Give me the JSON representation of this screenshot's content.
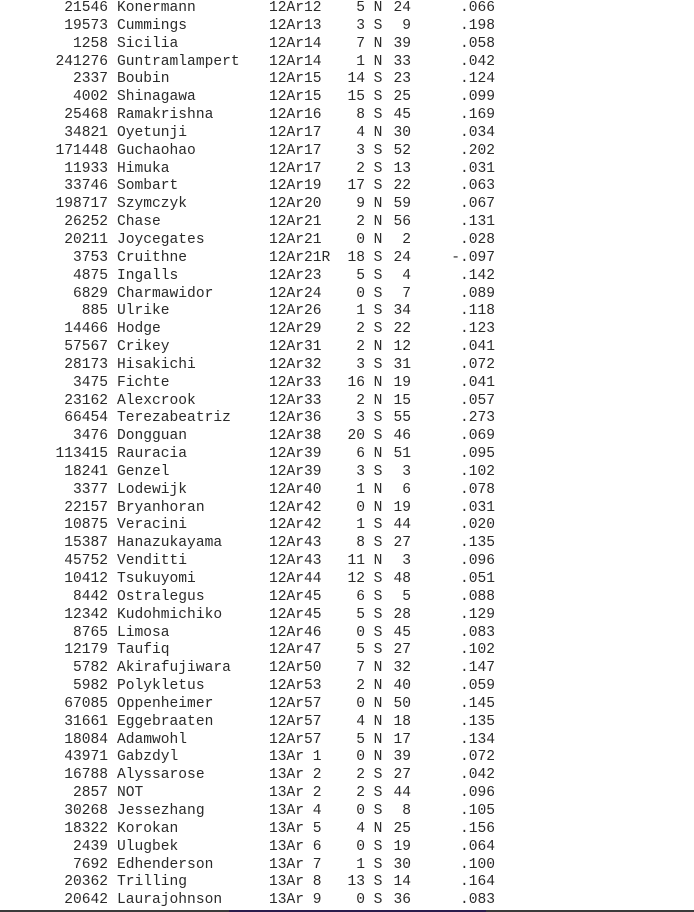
{
  "listing": {
    "rows": [
      {
        "number": "21546",
        "name": "Konermann",
        "code": "12Ar12",
        "deg": "5",
        "hem": "N",
        "min": "24",
        "value": ".066"
      },
      {
        "number": "19573",
        "name": "Cummings",
        "code": "12Ar13",
        "deg": "3",
        "hem": "S",
        "min": "9",
        "value": ".198"
      },
      {
        "number": "1258",
        "name": "Sicilia",
        "code": "12Ar14",
        "deg": "7",
        "hem": "N",
        "min": "39",
        "value": ".058"
      },
      {
        "number": "241276",
        "name": "Guntramlampert",
        "code": "12Ar14",
        "deg": "1",
        "hem": "N",
        "min": "33",
        "value": ".042"
      },
      {
        "number": "2337",
        "name": "Boubin",
        "code": "12Ar15",
        "deg": "14",
        "hem": "S",
        "min": "23",
        "value": ".124"
      },
      {
        "number": "4002",
        "name": "Shinagawa",
        "code": "12Ar15",
        "deg": "15",
        "hem": "S",
        "min": "25",
        "value": ".099"
      },
      {
        "number": "25468",
        "name": "Ramakrishna",
        "code": "12Ar16",
        "deg": "8",
        "hem": "S",
        "min": "45",
        "value": ".169"
      },
      {
        "number": "34821",
        "name": "Oyetunji",
        "code": "12Ar17",
        "deg": "4",
        "hem": "N",
        "min": "30",
        "value": ".034"
      },
      {
        "number": "171448",
        "name": "Guchaohao",
        "code": "12Ar17",
        "deg": "3",
        "hem": "S",
        "min": "52",
        "value": ".202"
      },
      {
        "number": "11933",
        "name": "Himuka",
        "code": "12Ar17",
        "deg": "2",
        "hem": "S",
        "min": "13",
        "value": ".031"
      },
      {
        "number": "33746",
        "name": "Sombart",
        "code": "12Ar19",
        "deg": "17",
        "hem": "S",
        "min": "22",
        "value": ".063"
      },
      {
        "number": "198717",
        "name": "Szymczyk",
        "code": "12Ar20",
        "deg": "9",
        "hem": "N",
        "min": "59",
        "value": ".067"
      },
      {
        "number": "26252",
        "name": "Chase",
        "code": "12Ar21",
        "deg": "2",
        "hem": "N",
        "min": "56",
        "value": ".131"
      },
      {
        "number": "20211",
        "name": "Joycegates",
        "code": "12Ar21",
        "deg": "0",
        "hem": "N",
        "min": "2",
        "value": ".028"
      },
      {
        "number": "3753",
        "name": "Cruithne",
        "code": "12Ar21R",
        "deg": "18",
        "hem": "S",
        "min": "24",
        "value": "-.097"
      },
      {
        "number": "4875",
        "name": "Ingalls",
        "code": "12Ar23",
        "deg": "5",
        "hem": "S",
        "min": "4",
        "value": ".142"
      },
      {
        "number": "6829",
        "name": "Charmawidor",
        "code": "12Ar24",
        "deg": "0",
        "hem": "S",
        "min": "7",
        "value": ".089"
      },
      {
        "number": "885",
        "name": "Ulrike",
        "code": "12Ar26",
        "deg": "1",
        "hem": "S",
        "min": "34",
        "value": ".118"
      },
      {
        "number": "14466",
        "name": "Hodge",
        "code": "12Ar29",
        "deg": "2",
        "hem": "S",
        "min": "22",
        "value": ".123"
      },
      {
        "number": "57567",
        "name": "Crikey",
        "code": "12Ar31",
        "deg": "2",
        "hem": "N",
        "min": "12",
        "value": ".041"
      },
      {
        "number": "28173",
        "name": "Hisakichi",
        "code": "12Ar32",
        "deg": "3",
        "hem": "S",
        "min": "31",
        "value": ".072"
      },
      {
        "number": "3475",
        "name": "Fichte",
        "code": "12Ar33",
        "deg": "16",
        "hem": "N",
        "min": "19",
        "value": ".041"
      },
      {
        "number": "23162",
        "name": "Alexcrook",
        "code": "12Ar33",
        "deg": "2",
        "hem": "N",
        "min": "15",
        "value": ".057"
      },
      {
        "number": "66454",
        "name": "Terezabeatriz",
        "code": "12Ar36",
        "deg": "3",
        "hem": "S",
        "min": "55",
        "value": ".273"
      },
      {
        "number": "3476",
        "name": "Dongguan",
        "code": "12Ar38",
        "deg": "20",
        "hem": "S",
        "min": "46",
        "value": ".069"
      },
      {
        "number": "113415",
        "name": "Rauracia",
        "code": "12Ar39",
        "deg": "6",
        "hem": "N",
        "min": "51",
        "value": ".095"
      },
      {
        "number": "18241",
        "name": "Genzel",
        "code": "12Ar39",
        "deg": "3",
        "hem": "S",
        "min": "3",
        "value": ".102"
      },
      {
        "number": "3377",
        "name": "Lodewijk",
        "code": "12Ar40",
        "deg": "1",
        "hem": "N",
        "min": "6",
        "value": ".078"
      },
      {
        "number": "22157",
        "name": "Bryanhoran",
        "code": "12Ar42",
        "deg": "0",
        "hem": "N",
        "min": "19",
        "value": ".031"
      },
      {
        "number": "10875",
        "name": "Veracini",
        "code": "12Ar42",
        "deg": "1",
        "hem": "S",
        "min": "44",
        "value": ".020"
      },
      {
        "number": "15387",
        "name": "Hanazukayama",
        "code": "12Ar43",
        "deg": "8",
        "hem": "S",
        "min": "27",
        "value": ".135"
      },
      {
        "number": "45752",
        "name": "Venditti",
        "code": "12Ar43",
        "deg": "11",
        "hem": "N",
        "min": "3",
        "value": ".096"
      },
      {
        "number": "10412",
        "name": "Tsukuyomi",
        "code": "12Ar44",
        "deg": "12",
        "hem": "S",
        "min": "48",
        "value": ".051"
      },
      {
        "number": "8442",
        "name": "Ostralegus",
        "code": "12Ar45",
        "deg": "6",
        "hem": "S",
        "min": "5",
        "value": ".088"
      },
      {
        "number": "12342",
        "name": "Kudohmichiko",
        "code": "12Ar45",
        "deg": "5",
        "hem": "S",
        "min": "28",
        "value": ".129"
      },
      {
        "number": "8765",
        "name": "Limosa",
        "code": "12Ar46",
        "deg": "0",
        "hem": "S",
        "min": "45",
        "value": ".083"
      },
      {
        "number": "12179",
        "name": "Taufiq",
        "code": "12Ar47",
        "deg": "5",
        "hem": "S",
        "min": "27",
        "value": ".102"
      },
      {
        "number": "5782",
        "name": "Akirafujiwara",
        "code": "12Ar50",
        "deg": "7",
        "hem": "N",
        "min": "32",
        "value": ".147"
      },
      {
        "number": "5982",
        "name": "Polykletus",
        "code": "12Ar53",
        "deg": "2",
        "hem": "N",
        "min": "40",
        "value": ".059"
      },
      {
        "number": "67085",
        "name": "Oppenheimer",
        "code": "12Ar57",
        "deg": "0",
        "hem": "N",
        "min": "50",
        "value": ".145"
      },
      {
        "number": "31661",
        "name": "Eggebraaten",
        "code": "12Ar57",
        "deg": "4",
        "hem": "N",
        "min": "18",
        "value": ".135"
      },
      {
        "number": "18084",
        "name": "Adamwohl",
        "code": "12Ar57",
        "deg": "5",
        "hem": "N",
        "min": "17",
        "value": ".134"
      },
      {
        "number": "43971",
        "name": "Gabzdyl",
        "code": "13Ar 1",
        "deg": "0",
        "hem": "N",
        "min": "39",
        "value": ".072"
      },
      {
        "number": "16788",
        "name": "Alyssarose",
        "code": "13Ar 2",
        "deg": "2",
        "hem": "S",
        "min": "27",
        "value": ".042"
      },
      {
        "number": "2857",
        "name": "NOT",
        "code": "13Ar 2",
        "deg": "2",
        "hem": "S",
        "min": "44",
        "value": ".096"
      },
      {
        "number": "30268",
        "name": "Jessezhang",
        "code": "13Ar 4",
        "deg": "0",
        "hem": "S",
        "min": "8",
        "value": ".105"
      },
      {
        "number": "18322",
        "name": "Korokan",
        "code": "13Ar 5",
        "deg": "4",
        "hem": "N",
        "min": "25",
        "value": ".156"
      },
      {
        "number": "2439",
        "name": "Ulugbek",
        "code": "13Ar 6",
        "deg": "0",
        "hem": "S",
        "min": "19",
        "value": ".064"
      },
      {
        "number": "7692",
        "name": "Edhenderson",
        "code": "13Ar 7",
        "deg": "1",
        "hem": "S",
        "min": "30",
        "value": ".100"
      },
      {
        "number": "20362",
        "name": "Trilling",
        "code": "13Ar 8",
        "deg": "13",
        "hem": "S",
        "min": "14",
        "value": ".164"
      },
      {
        "number": "20642",
        "name": "Laurajohnson",
        "code": "13Ar 9",
        "deg": "0",
        "hem": "S",
        "min": "36",
        "value": ".083"
      }
    ]
  }
}
